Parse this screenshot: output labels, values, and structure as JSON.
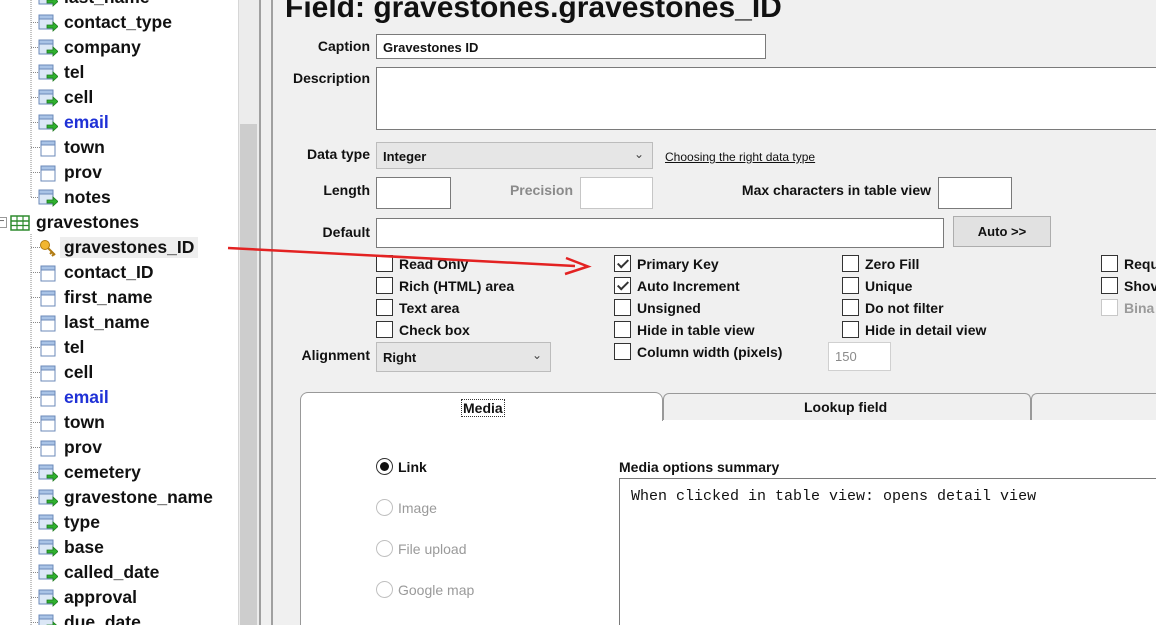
{
  "tree": {
    "items_top": [
      {
        "label": "last_name",
        "icon": "field-link-icon"
      },
      {
        "label": "contact_type",
        "icon": "field-link-icon"
      },
      {
        "label": "company",
        "icon": "field-link-icon"
      },
      {
        "label": "tel",
        "icon": "field-link-icon"
      },
      {
        "label": "cell",
        "icon": "field-link-icon"
      },
      {
        "label": "email",
        "icon": "field-link-icon",
        "blue": true
      },
      {
        "label": "town",
        "icon": "field-icon"
      },
      {
        "label": "prov",
        "icon": "field-icon"
      },
      {
        "label": "notes",
        "icon": "field-link-icon"
      }
    ],
    "table": {
      "label": "gravestones",
      "icon": "table-icon"
    },
    "items_table": [
      {
        "label": "gravestones_ID",
        "icon": "key-icon",
        "selected": true
      },
      {
        "label": "contact_ID",
        "icon": "field-icon"
      },
      {
        "label": "first_name",
        "icon": "field-icon"
      },
      {
        "label": "last_name",
        "icon": "field-icon"
      },
      {
        "label": "tel",
        "icon": "field-icon"
      },
      {
        "label": "cell",
        "icon": "field-icon"
      },
      {
        "label": "email",
        "icon": "field-icon",
        "blue": true
      },
      {
        "label": "town",
        "icon": "field-icon"
      },
      {
        "label": "prov",
        "icon": "field-icon"
      },
      {
        "label": "cemetery",
        "icon": "field-link-icon"
      },
      {
        "label": "gravestone_name",
        "icon": "field-link-icon"
      },
      {
        "label": "type",
        "icon": "field-link-icon"
      },
      {
        "label": "base",
        "icon": "field-link-icon"
      },
      {
        "label": "called_date",
        "icon": "field-link-icon"
      },
      {
        "label": "approval",
        "icon": "field-link-icon"
      },
      {
        "label": "due_date",
        "icon": "field-link-icon"
      }
    ]
  },
  "form": {
    "title": "Field: gravestones.gravestones_ID",
    "caption_label": "Caption",
    "caption_value": "Gravestones ID",
    "description_label": "Description",
    "description_value": "",
    "datatype_label": "Data type",
    "datatype_value": "Integer",
    "datatype_link": "Choosing the right data type",
    "length_label": "Length",
    "length_value": "",
    "precision_label": "Precision",
    "precision_value": "",
    "maxchars_label": "Max characters in table view",
    "maxchars_value": "",
    "default_label": "Default",
    "default_value": "",
    "auto_button": "Auto >>",
    "checkboxes": [
      {
        "label": "Read Only",
        "checked": false
      },
      {
        "label": "Rich (HTML) area",
        "checked": false
      },
      {
        "label": "Text area",
        "checked": false
      },
      {
        "label": "Check box",
        "checked": false
      },
      {
        "label": "Primary Key",
        "checked": true
      },
      {
        "label": "Auto Increment",
        "checked": true
      },
      {
        "label": "Unsigned",
        "checked": false
      },
      {
        "label": "Hide in table view",
        "checked": false
      },
      {
        "label": "Column width (pixels)",
        "checked": false
      },
      {
        "label": "Zero Fill",
        "checked": false
      },
      {
        "label": "Unique",
        "checked": false
      },
      {
        "label": "Do not filter",
        "checked": false
      },
      {
        "label": "Hide in detail view",
        "checked": false
      },
      {
        "label": "Requ",
        "checked": false
      },
      {
        "label": "Shov",
        "checked": false
      },
      {
        "label": "Bina",
        "checked": false,
        "disabled": true
      }
    ],
    "column_width_value": "150",
    "alignment_label": "Alignment",
    "alignment_value": "Right",
    "tabs": [
      {
        "label": "Media",
        "active": true
      },
      {
        "label": "Lookup field",
        "active": false
      }
    ],
    "media_options": [
      {
        "label": "Link",
        "selected": true,
        "disabled": false
      },
      {
        "label": "Image",
        "selected": false,
        "disabled": true
      },
      {
        "label": "File upload",
        "selected": false,
        "disabled": true
      },
      {
        "label": "Google map",
        "selected": false,
        "disabled": true
      }
    ],
    "summary_label": "Media options summary",
    "summary_text": "When clicked in table view: opens detail view"
  },
  "colors": {
    "annotation_arrow": "#e32222",
    "link_blue": "#1f31d6"
  }
}
